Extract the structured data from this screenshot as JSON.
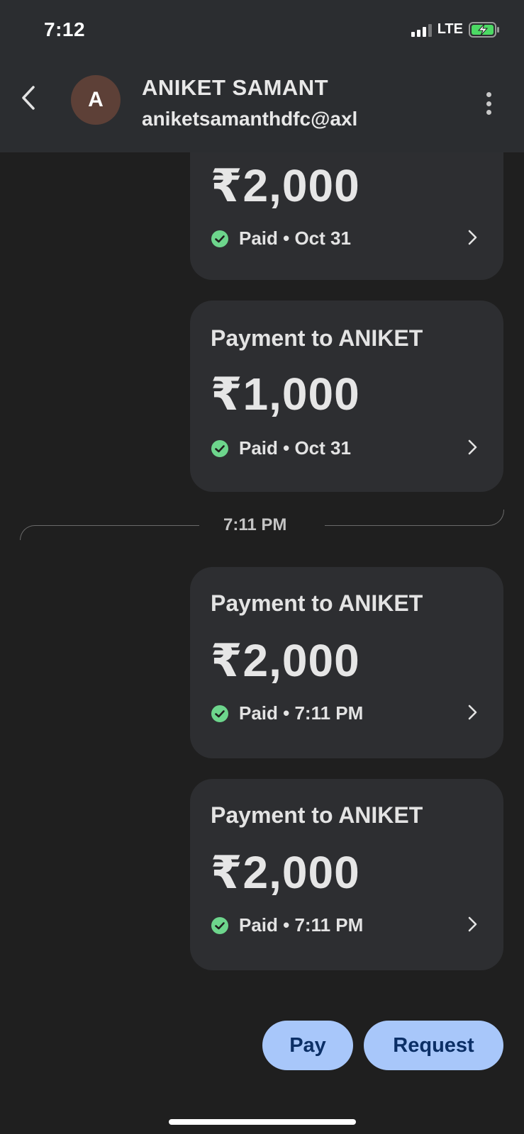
{
  "status_bar": {
    "time": "7:12",
    "network": "LTE",
    "icons": [
      "signal-icon",
      "battery-charging-icon"
    ]
  },
  "header": {
    "back_icon": "chevron-left-icon",
    "avatar_initial": "A",
    "avatar_color": "#5d4037",
    "contact_name": "ANIKET SAMANT",
    "contact_upi": "aniketsamanthdfc@axl",
    "menu_icon": "more-vertical-icon"
  },
  "messages": [
    {
      "title": "",
      "amount": "₹2,000",
      "status": "Paid • Oct 31"
    },
    {
      "title": "Payment to ANIKET",
      "amount": "₹1,000",
      "status": "Paid • Oct 31"
    },
    {
      "title": "Payment to ANIKET",
      "amount": "₹2,000",
      "status": "Paid • 7:11 PM"
    },
    {
      "title": "Payment to ANIKET",
      "amount": "₹2,000",
      "status": "Paid • 7:11 PM"
    }
  ],
  "time_divider": "7:11 PM",
  "actions": {
    "pay_label": "Pay",
    "request_label": "Request"
  },
  "colors": {
    "background": "#1f1f1f",
    "header_background": "#2b2d30",
    "card_background": "#2d2e31",
    "paid_check": "#6dd58c",
    "button_background": "#a8c7fa",
    "button_text": "#0b2f66",
    "battery_charging": "#4cd964"
  }
}
